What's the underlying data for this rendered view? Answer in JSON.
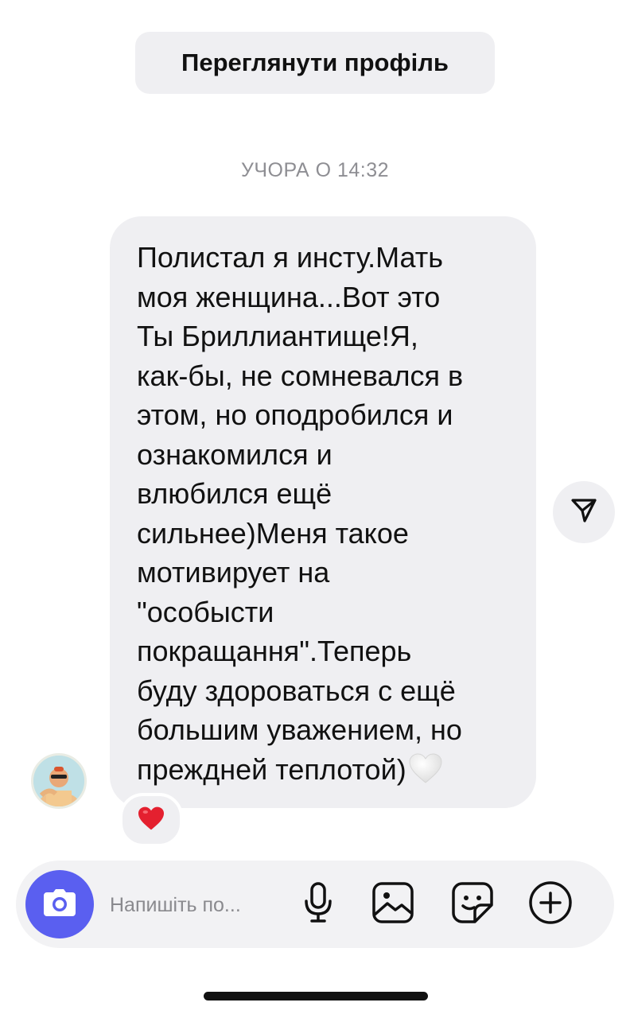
{
  "header": {
    "view_profile_label": "Переглянути профіль"
  },
  "chat": {
    "timestamp": "УЧОРА О 14:32",
    "message_lines": [
      "Полистал я инсту.Мать",
      "моя женщина...Вот это",
      "Ты Бриллиантище!Я,",
      "как-бы, не сомневался в",
      "этом, но оподробился и",
      "ознакомился и",
      "влюбился ещё",
      "сильнее)Меня такое",
      "мотивирует на",
      "\"особысти",
      "покращання\".Теперь",
      "буду здороваться с ещё",
      "большим уважением, но",
      "преждней теплотой)"
    ],
    "message_trailing_emoji": "white-heart-emoji",
    "reaction": "red-heart-emoji",
    "share_icon": "send-icon",
    "sender_avatar": "avatar"
  },
  "composer": {
    "placeholder": "Напишіть по...",
    "icons": [
      "camera-icon",
      "microphone-icon",
      "gallery-icon",
      "sticker-icon",
      "plus-circle-icon"
    ],
    "accent_color": "#5a5ff0"
  },
  "colors": {
    "bubble_bg": "#efeff2",
    "timestamp": "#8e8e93",
    "text": "#111111"
  }
}
